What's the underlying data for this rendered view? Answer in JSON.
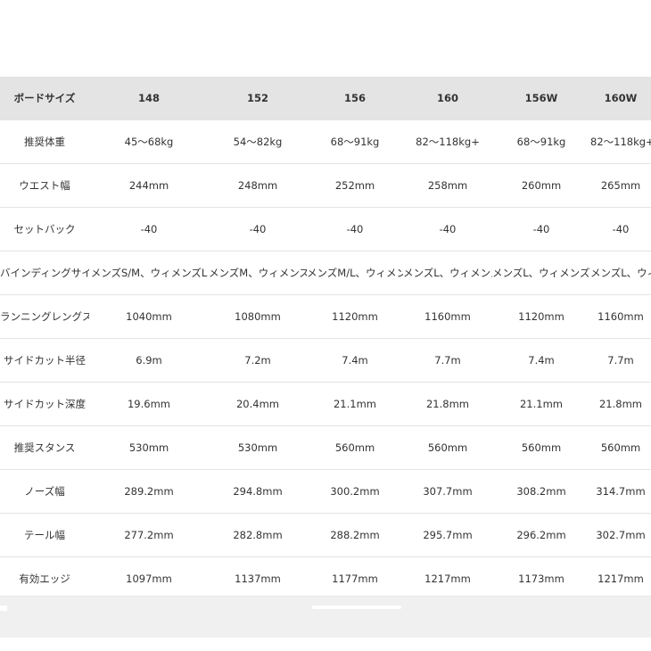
{
  "table": {
    "header": [
      "ボードサイズ",
      "148",
      "152",
      "156",
      "160",
      "156W",
      "160W"
    ],
    "rows": [
      {
        "label": "推奨体重",
        "values": [
          "45～68kg",
          "54～82kg",
          "68～91kg",
          "82～118kg+",
          "68～91kg",
          "82～118kg+"
        ]
      },
      {
        "label": "ウエスト幅",
        "values": [
          "244mm",
          "248mm",
          "252mm",
          "258mm",
          "260mm",
          "265mm"
        ]
      },
      {
        "label": "セットバック",
        "values": [
          "-40",
          "-40",
          "-40",
          "-40",
          "-40",
          "-40"
        ]
      },
      {
        "label": "バインディングサイズ",
        "values": [
          "メンズS/M、ウィメンズL",
          "メンズM、ウィメンズL",
          "メンズM/L、ウィメンズL",
          "メンズL、ウィメンズL",
          "メンズL、ウィメンズL",
          "メンズL、ウィメンズL"
        ]
      },
      {
        "label": "ランニングレングス",
        "values": [
          "1040mm",
          "1080mm",
          "1120mm",
          "1160mm",
          "1120mm",
          "1160mm"
        ]
      },
      {
        "label": "サイドカット半径",
        "values": [
          "6.9m",
          "7.2m",
          "7.4m",
          "7.7m",
          "7.4m",
          "7.7m"
        ]
      },
      {
        "label": "サイドカット深度",
        "values": [
          "19.6mm",
          "20.4mm",
          "21.1mm",
          "21.8mm",
          "21.1mm",
          "21.8mm"
        ]
      },
      {
        "label": "推奨スタンス",
        "values": [
          "530mm",
          "530mm",
          "560mm",
          "560mm",
          "560mm",
          "560mm"
        ]
      },
      {
        "label": "ノーズ幅",
        "values": [
          "289.2mm",
          "294.8mm",
          "300.2mm",
          "307.7mm",
          "308.2mm",
          "314.7mm"
        ]
      },
      {
        "label": "テール幅",
        "values": [
          "277.2mm",
          "282.8mm",
          "288.2mm",
          "295.7mm",
          "296.2mm",
          "302.7mm"
        ]
      },
      {
        "label": "有効エッジ",
        "values": [
          "1097mm",
          "1137mm",
          "1177mm",
          "1217mm",
          "1173mm",
          "1217mm"
        ]
      }
    ]
  },
  "scrollbar": {
    "position": 0.5
  }
}
